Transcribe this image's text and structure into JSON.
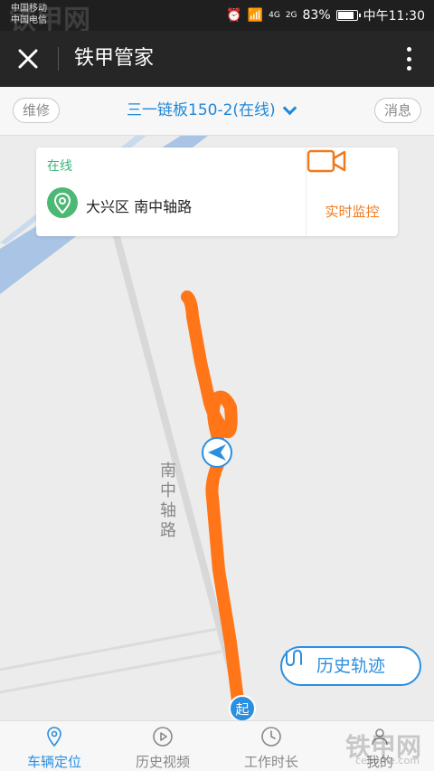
{
  "status_bar": {
    "carrier1": "中国移动",
    "carrier2": "中国电信",
    "network1": "4G",
    "network2": "2G",
    "battery": "83%",
    "time": "中午11:30"
  },
  "title_bar": {
    "title": "铁甲管家"
  },
  "sub_bar": {
    "left_pill": "维修",
    "device": "三一链板150-2(在线)",
    "right_pill": "消息"
  },
  "info_card": {
    "status": "在线",
    "address": "大兴区 南中轴路",
    "monitor_label": "实时监控"
  },
  "map": {
    "road_label": "南中轴路",
    "start_marker": "起",
    "history_button": "历史轨迹",
    "track_color": "#ff7517",
    "accent_color": "#2b8fe0"
  },
  "tabs": [
    {
      "label": "车辆定位",
      "icon": "location-pin-icon",
      "active": true
    },
    {
      "label": "历史视频",
      "icon": "play-icon",
      "active": false
    },
    {
      "label": "工作时长",
      "icon": "clock-icon",
      "active": false
    },
    {
      "label": "我的",
      "icon": "user-icon",
      "active": false
    }
  ],
  "watermark": {
    "brand": "铁甲网",
    "domain": "cehome.com"
  }
}
